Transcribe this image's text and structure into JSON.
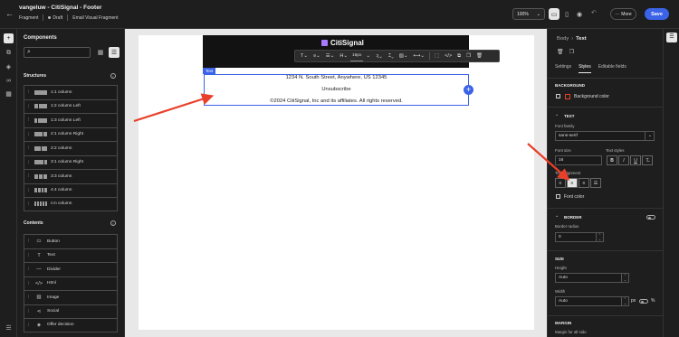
{
  "header": {
    "title": "vangeluw - CitiSignal - Footer",
    "type_label": "Fragment",
    "status": "Draft",
    "editor_label": "Email Visual Fragment",
    "zoom": "100%",
    "more_label": "More",
    "save_label": "Save"
  },
  "components_panel": {
    "title": "Components",
    "search_placeholder": "",
    "structures_title": "Structures",
    "structures": [
      {
        "label": "1:1 column",
        "cols": [
          1
        ]
      },
      {
        "label": "1:2 column Left",
        "cols": [
          1,
          2
        ]
      },
      {
        "label": "1:3 column Left",
        "cols": [
          1,
          3
        ]
      },
      {
        "label": "2:1 column Right",
        "cols": [
          2,
          1
        ]
      },
      {
        "label": "2:2 column",
        "cols": [
          1,
          1
        ]
      },
      {
        "label": "3:1 column Right",
        "cols": [
          3,
          1
        ]
      },
      {
        "label": "3:3 column",
        "cols": [
          1,
          1,
          1
        ]
      },
      {
        "label": "4:4 column",
        "cols": [
          1,
          1,
          1,
          1
        ]
      },
      {
        "label": "n:n column",
        "cols": [
          1,
          1,
          1,
          1,
          1
        ]
      }
    ],
    "contents_title": "Contents",
    "contents": [
      {
        "label": "Button",
        "icon": "button-icon",
        "glyph": "▭"
      },
      {
        "label": "Text",
        "icon": "text-icon",
        "glyph": "T"
      },
      {
        "label": "Divider",
        "icon": "divider-icon",
        "glyph": "—"
      },
      {
        "label": "Html",
        "icon": "html-icon",
        "glyph": "</>"
      },
      {
        "label": "Image",
        "icon": "image-icon",
        "glyph": "▨"
      },
      {
        "label": "Social",
        "icon": "social-icon",
        "glyph": "⋖"
      },
      {
        "label": "Offer decision",
        "icon": "offer-icon",
        "glyph": "◈"
      }
    ]
  },
  "canvas": {
    "brand_name": "CitiSignal",
    "font_size": "16px",
    "text_badge": "Text",
    "lines": [
      "1234 N. South Street, Anywhere, US 12345",
      "Unsubscribe",
      "©2024 CitiSignal, Inc and its affiliates. All rights reserved."
    ]
  },
  "properties": {
    "breadcrumb_parent": "Body",
    "breadcrumb_current": "Text",
    "tabs": [
      "Settings",
      "Styles",
      "Editable fields"
    ],
    "active_tab": "Styles",
    "background_title": "BACKGROUND",
    "background_color_label": "Background color",
    "text_title": "TEXT",
    "font_family_label": "Font family",
    "font_family_value": "sans-serif",
    "font_size_label": "Font size",
    "font_size_value": "16",
    "text_styles_label": "Text styles",
    "text_alignment_label": "Text alignment",
    "font_color_label": "Font color",
    "border_title": "BORDER",
    "border_radius_label": "Border radius",
    "border_radius_value": "0",
    "size_title": "SIZE",
    "height_label": "Height",
    "height_value": "Auto",
    "width_label": "Width",
    "width_value": "Auto",
    "width_unit_px": "px",
    "width_unit_pct": "%",
    "margin_title": "MARGIN",
    "margin_all_label": "Margin for all side"
  },
  "colors": {
    "accent": "#3b63e8",
    "annotation_arrow": "#e8402a",
    "brand": "#a97aff"
  }
}
